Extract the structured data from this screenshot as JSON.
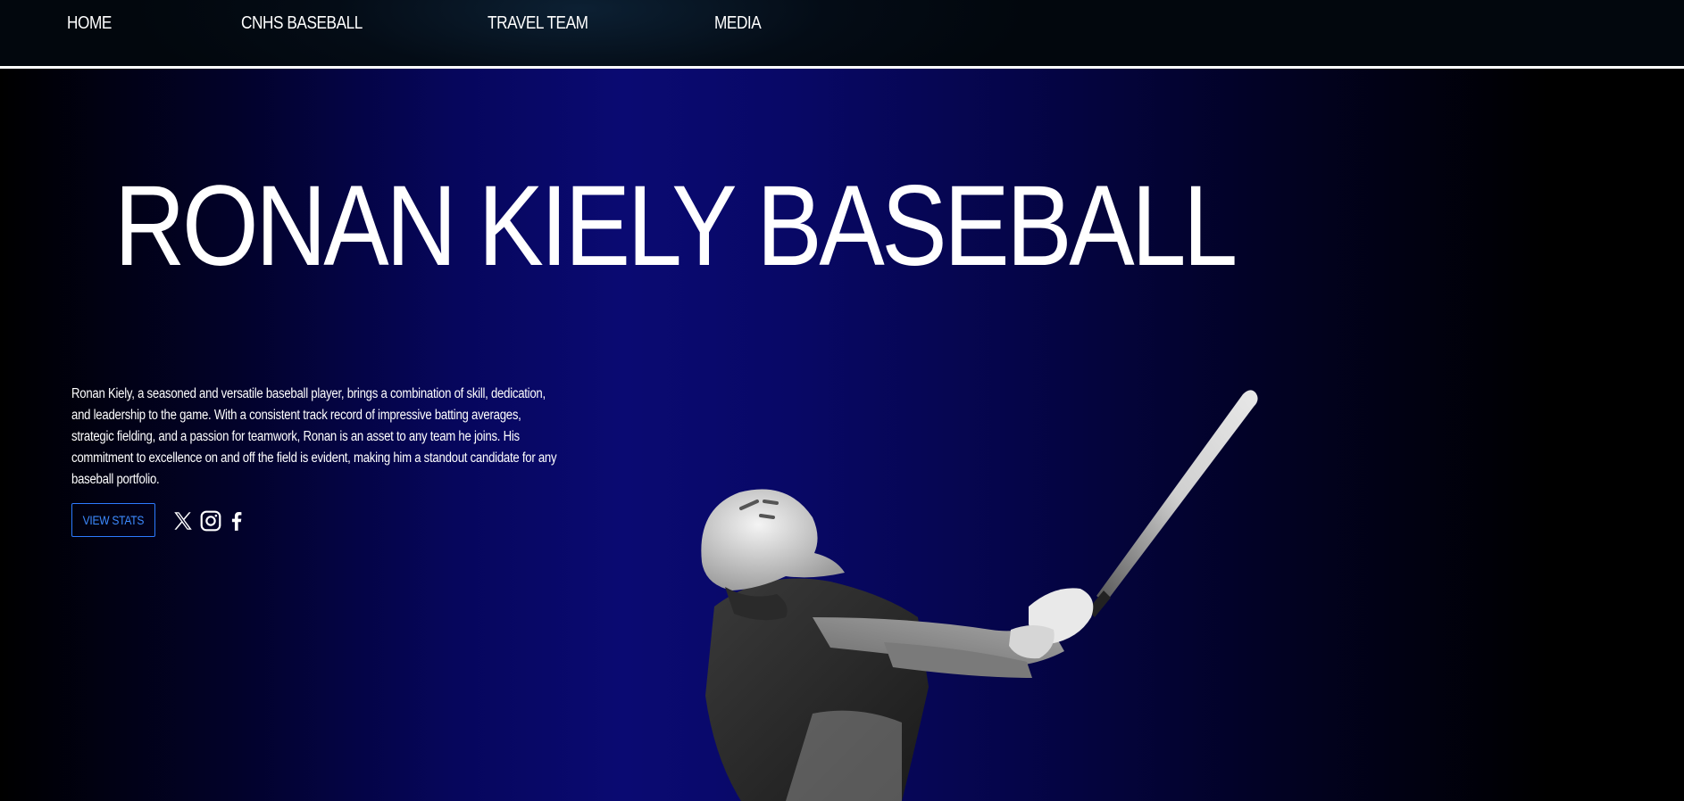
{
  "nav": {
    "items": [
      {
        "label": "HOME"
      },
      {
        "label": "CNHS BASEBALL"
      },
      {
        "label": "TRAVEL TEAM"
      },
      {
        "label": "MEDIA"
      }
    ]
  },
  "hero": {
    "title": "RONAN KIELY BASEBALL",
    "bio": "Ronan Kiely, a seasoned and versatile baseball player, brings a combination of skill, dedication, and leadership to the game. With a consistent track record of impressive batting averages, strategic fielding, and a passion for teamwork, Ronan is an asset to any team he joins. His commitment to excellence on and off the field is evident, making him a standout candidate for any baseball portfolio.",
    "cta_label": "VIEW STATS"
  },
  "social": [
    {
      "icon": "x-twitter-icon"
    },
    {
      "icon": "instagram-icon"
    },
    {
      "icon": "facebook-icon"
    }
  ],
  "colors": {
    "accent": "#2d7bff",
    "background_glow": "#0a0a72",
    "text": "#ffffff"
  }
}
